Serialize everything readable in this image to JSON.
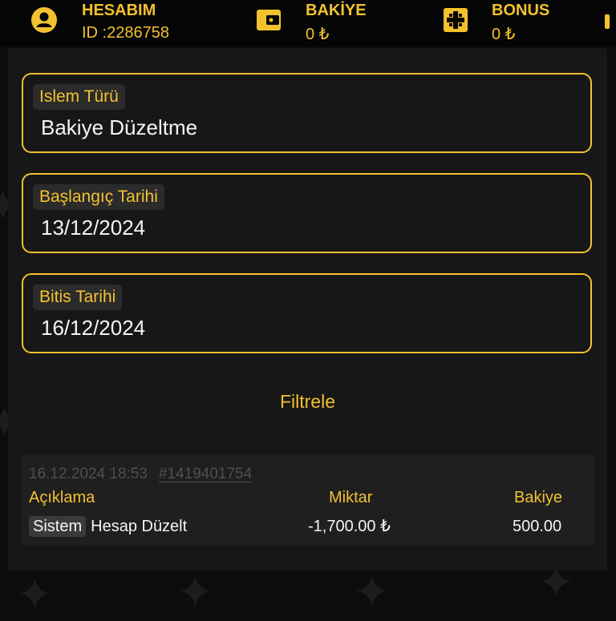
{
  "header": {
    "account": {
      "title": "HESABIM",
      "value": "ID :2286758",
      "icon": "user-circle-icon"
    },
    "balance": {
      "title": "BAKİYE",
      "value": "0 ₺",
      "icon": "wallet-icon"
    },
    "bonus": {
      "title": "BONUS",
      "value": "0 ₺",
      "icon": "bonus-gift-icon"
    }
  },
  "filters": {
    "transaction_type": {
      "label": "Islem Türü",
      "value": "Bakiye Düzeltme"
    },
    "start_date": {
      "label": "Başlangıç Tarihi",
      "value": "13/12/2024"
    },
    "end_date": {
      "label": "Bitis Tarihi",
      "value": "16/12/2024"
    },
    "submit_label": "Filtrele"
  },
  "transactions": [
    {
      "datetime": "16.12.2024 18:53",
      "id": "#1419401754",
      "headers": {
        "description": "Açıklama",
        "amount": "Miktar",
        "balance": "Bakiye"
      },
      "badge": "Sistem",
      "description": "Hesap Düzelt",
      "amount": "-1,700.00 ₺",
      "balance": "500.00"
    }
  ],
  "colors": {
    "accent": "#f2c12e",
    "background": "#0c0c0c",
    "panel": "#171717",
    "text": "#f4f4f4",
    "muted": "#4e4e4e"
  }
}
